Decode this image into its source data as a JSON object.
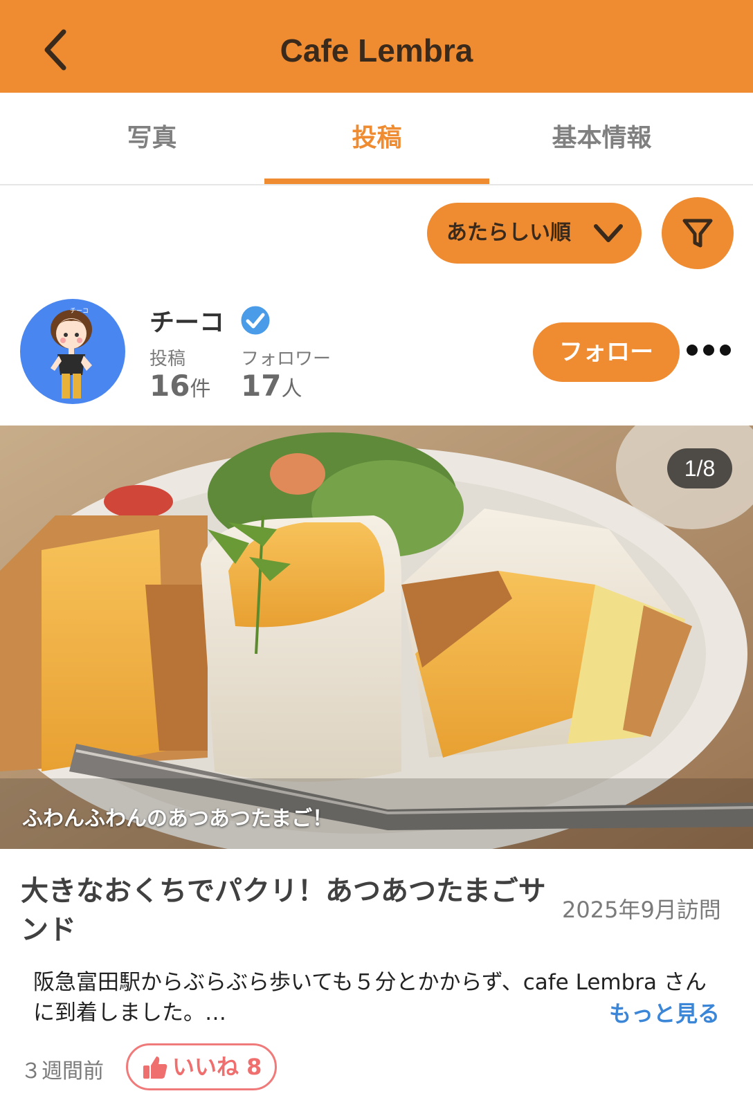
{
  "header": {
    "title": "Cafe Lembra",
    "back_icon": "chevron-left-icon"
  },
  "tabs": [
    {
      "label": "写真",
      "active": false
    },
    {
      "label": "投稿",
      "active": true
    },
    {
      "label": "基本情報",
      "active": false
    }
  ],
  "toolbar": {
    "sort_label": "あたらしい順",
    "sort_icon": "chevron-down-icon",
    "filter_icon": "filter-icon"
  },
  "user": {
    "name": "チーコ",
    "avatar_tag": "チーコ",
    "posts_label": "投稿",
    "posts_count": "16",
    "posts_unit": "件",
    "followers_label": "フォロワー",
    "followers_count": "17",
    "followers_unit": "人",
    "follow_label": "フォロー"
  },
  "photo": {
    "counter": "1/8",
    "caption": "ふわんふわんのあつあつたまご！"
  },
  "post": {
    "title": "大きなおくちでパクリ！あつあつたまごサンド",
    "visit_date": "2025年9月訪問",
    "body": "阪急富田駅からぶらぶら歩いても５分とかからず、cafe Lembra さんに到着しました。…",
    "more_link": "もっと見る",
    "time_ago": "３週間前",
    "like_label": "いいね",
    "like_count": "8"
  },
  "colors": {
    "accent": "#ef8b31",
    "link": "#3c86d8",
    "like": "#ef6f6f",
    "verified": "#4a9be8"
  }
}
